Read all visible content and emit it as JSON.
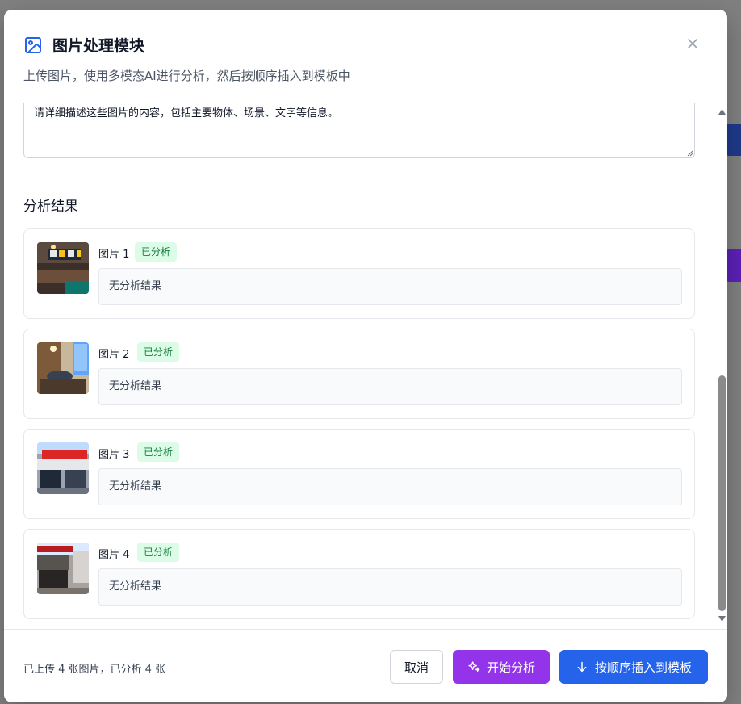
{
  "colors": {
    "accent_purple": "#9333ea",
    "accent_blue": "#2563eb",
    "badge_bg": "#dcfce7",
    "badge_text": "#15803d"
  },
  "modal": {
    "title_icon": "image-icon",
    "title": "图片处理模块",
    "subtitle": "上传图片，使用多模态AI进行分析，然后按顺序插入到模板中",
    "close_icon": "close-icon"
  },
  "prompt": {
    "value": "请详细描述这些图片的内容，包括主要物体、场景、文字等信息。"
  },
  "results": {
    "section_title": "分析结果",
    "items": [
      {
        "label": "图片 1",
        "status": "已分析",
        "text": "无分析结果",
        "thumbnail": "restaurant-interior-photo"
      },
      {
        "label": "图片 2",
        "status": "已分析",
        "text": "无分析结果",
        "thumbnail": "restaurant-dining-photo"
      },
      {
        "label": "图片 3",
        "status": "已分析",
        "text": "无分析结果",
        "thumbnail": "storefront-street-photo"
      },
      {
        "label": "图片 4",
        "status": "已分析",
        "text": "无分析结果",
        "thumbnail": "street-shops-photo"
      }
    ]
  },
  "footer": {
    "status": "已上传 4 张图片，已分析 4 张",
    "cancel_label": "取消",
    "analyze_label": "开始分析",
    "analyze_icon": "sparkles-icon",
    "insert_label": "按顺序插入到模板",
    "insert_icon": "arrow-down-icon"
  }
}
